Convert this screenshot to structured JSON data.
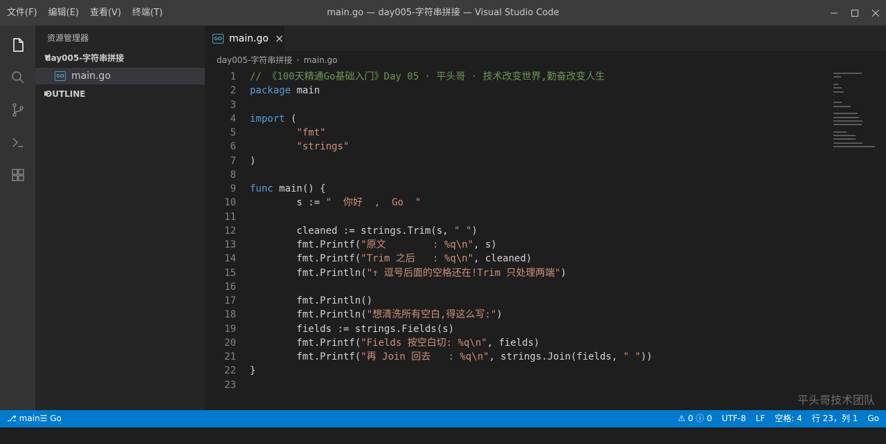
{
  "menu": [
    "文件(F)",
    "编辑(E)",
    "查看(V)",
    "终端(T)"
  ],
  "window_title": "main.go — day005-字符串拼接 — Visual Studio Code",
  "sidebar": {
    "title": "资源管理器",
    "folder": "day005-字符串拼接",
    "file": "main.go",
    "outline": "OUTLINE",
    "file_icon": "GO"
  },
  "tab": {
    "label": "main.go",
    "icon": "GO",
    "close": "×"
  },
  "breadcrumb": {
    "folder": "day005-字符串拼接",
    "sep": "›",
    "file": "main.go"
  },
  "code_lines": [
    [
      {
        "t": "// 《100天精通Go基础入门》Day 05 · 平头哥 · 技术改变世界,勤奋改变人生",
        "c": "comment"
      }
    ],
    [
      {
        "t": "package",
        "c": "kw"
      },
      {
        "t": " main",
        "c": "plain"
      }
    ],
    [],
    [
      {
        "t": "import",
        "c": "kw"
      },
      {
        "t": " (",
        "c": "plain"
      }
    ],
    [
      {
        "t": "        ",
        "c": "plain"
      },
      {
        "t": "\"fmt\"",
        "c": "str"
      }
    ],
    [
      {
        "t": "        ",
        "c": "plain"
      },
      {
        "t": "\"strings\"",
        "c": "str"
      }
    ],
    [
      {
        "t": ")",
        "c": "plain"
      }
    ],
    [],
    [
      {
        "t": "func",
        "c": "kw"
      },
      {
        "t": " main() {",
        "c": "plain"
      }
    ],
    [
      {
        "t": "        s := ",
        "c": "plain"
      },
      {
        "t": "\"  你好  ,  Go  \"",
        "c": "str"
      }
    ],
    [],
    [
      {
        "t": "        cleaned := strings.Trim(s, ",
        "c": "plain"
      },
      {
        "t": "\" \"",
        "c": "str"
      },
      {
        "t": ")",
        "c": "plain"
      }
    ],
    [
      {
        "t": "        fmt.Printf(",
        "c": "plain"
      },
      {
        "t": "\"原文        : %q\\n\"",
        "c": "str"
      },
      {
        "t": ", s)",
        "c": "plain"
      }
    ],
    [
      {
        "t": "        fmt.Printf(",
        "c": "plain"
      },
      {
        "t": "\"Trim 之后   : %q\\n\"",
        "c": "str"
      },
      {
        "t": ", cleaned)",
        "c": "plain"
      }
    ],
    [
      {
        "t": "        fmt.Println(",
        "c": "plain"
      },
      {
        "t": "\"↑ 逗号后面的空格还在!Trim 只处理两端\"",
        "c": "str"
      },
      {
        "t": ")",
        "c": "plain"
      }
    ],
    [],
    [
      {
        "t": "        fmt.Println()",
        "c": "plain"
      }
    ],
    [
      {
        "t": "        fmt.Println(",
        "c": "plain"
      },
      {
        "t": "\"想清洗所有空白,得这么写:\"",
        "c": "str"
      },
      {
        "t": ")",
        "c": "plain"
      }
    ],
    [
      {
        "t": "        fields := strings.Fields(s)",
        "c": "plain"
      }
    ],
    [
      {
        "t": "        fmt.Printf(",
        "c": "plain"
      },
      {
        "t": "\"Fields 按空白切: %q\\n\"",
        "c": "str"
      },
      {
        "t": ", fields)",
        "c": "plain"
      }
    ],
    [
      {
        "t": "        fmt.Printf(",
        "c": "plain"
      },
      {
        "t": "\"再 Join 回去   : %q\\n\"",
        "c": "str"
      },
      {
        "t": ", strings.Join(fields, ",
        "c": "plain"
      },
      {
        "t": "\" \"",
        "c": "str"
      },
      {
        "t": "))",
        "c": "plain"
      }
    ],
    [
      {
        "t": "}",
        "c": "plain"
      }
    ],
    []
  ],
  "watermark": "平头哥技术团队",
  "status": {
    "branch": "⎇ main☰ Go",
    "problems": "⚠ 0  ⓘ 0",
    "encoding": "UTF-8",
    "eol": "LF",
    "indent": "空格: 4",
    "position": "行 23，列 1",
    "language": "Go"
  },
  "colors": {
    "statusbar": "#007acc",
    "comment": "#6a9955",
    "keyword": "#569cd6",
    "string": "#ce9178"
  }
}
